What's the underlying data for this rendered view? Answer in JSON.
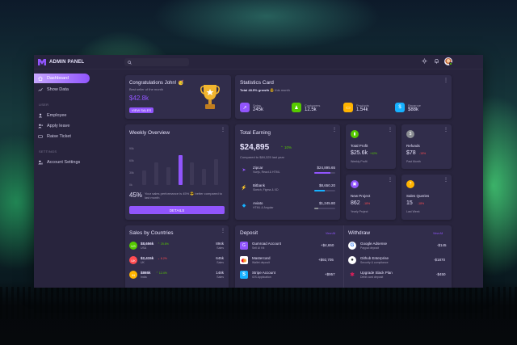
{
  "app": {
    "title": "ADMIN PANEL",
    "search_placeholder": ""
  },
  "sidebar": {
    "items": [
      {
        "label": "Dashboard",
        "icon": "home-icon",
        "active": true
      },
      {
        "label": "Show Data",
        "icon": "chart-line-icon",
        "active": false
      }
    ],
    "section_user": "USER",
    "user_items": [
      {
        "label": "Employee",
        "icon": "person-icon"
      },
      {
        "label": "Apply leave",
        "icon": "person-add-icon"
      },
      {
        "label": "Raise Ticket",
        "icon": "ticket-icon"
      }
    ],
    "section_settings": "SETTINGS",
    "settings_items": [
      {
        "label": "Account Settings",
        "icon": "account-settings-icon"
      }
    ]
  },
  "congrats": {
    "title": "Congratulations John! 🥳",
    "subtitle": "Best seller of the month",
    "amount": "$42.8k",
    "button": "VIEW SALES"
  },
  "statistics": {
    "title": "Statistics Card",
    "growth": "Total 48.5% growth",
    "growth_suffix": "😎 this month",
    "items": [
      {
        "label": "Sales",
        "value": "245k",
        "color": "#9155fd",
        "icon": "trending-up-icon"
      },
      {
        "label": "Customers",
        "value": "12.5k",
        "color": "#56ca00",
        "icon": "account-icon"
      },
      {
        "label": "Products",
        "value": "1.54k",
        "color": "#ffb400",
        "icon": "cellphone-icon"
      },
      {
        "label": "Revenue",
        "value": "$88k",
        "color": "#16b1ff",
        "icon": "currency-icon"
      }
    ]
  },
  "weekly": {
    "title": "Weekly Overview",
    "ticks": [
      "90k",
      "60k",
      "30k",
      "0k"
    ],
    "percent": "45%",
    "description": "Your sales performance is 45% 😎 better compared to last month",
    "button": "DETAILS",
    "chart_data": {
      "type": "bar",
      "categories": [
        "",
        "",
        "",
        "",
        "",
        "",
        ""
      ],
      "values": [
        37,
        57,
        45,
        75,
        57,
        40,
        65
      ],
      "ylim": [
        0,
        90
      ]
    }
  },
  "earning": {
    "title": "Total Earning",
    "amount": "$24,895",
    "change": "10%",
    "compared": "Compared to $84,325 last year",
    "rows": [
      {
        "name": "Zipcar",
        "sub": "Vuejs, React & HTML",
        "value": "$24,895.65",
        "progress": 0.75,
        "color": "#9155fd",
        "icon": "zipcar-icon"
      },
      {
        "name": "Bitbank",
        "sub": "Sketch, Figma & XD",
        "value": "$8,650.20",
        "progress": 0.5,
        "color": "#16b1ff",
        "icon": "bitbank-icon"
      },
      {
        "name": "Aviato",
        "sub": "HTML & Angular",
        "value": "$1,245.80",
        "progress": 0.2,
        "color": "#8a8d93",
        "icon": "aviato-icon"
      }
    ]
  },
  "total_profit": {
    "title": "Total Profit",
    "value": "$25.6k",
    "change": "+42%",
    "sub": "Weekly Profit",
    "color": "#56ca00",
    "icon": "poll-icon"
  },
  "refunds": {
    "title": "Refunds",
    "value": "$78",
    "change": "-15%",
    "sub": "Past Month",
    "color": "#8a8d93",
    "icon": "currency-icon"
  },
  "new_project": {
    "title": "New Project",
    "value": "862",
    "change": "-18%",
    "sub": "Yearly Project",
    "color": "#9155fd",
    "icon": "briefcase-icon"
  },
  "sales_queries": {
    "title": "Sales Queries",
    "value": "15",
    "change": "-18%",
    "sub": "Last Week",
    "color": "#ffb400",
    "icon": "help-icon"
  },
  "countries": {
    "title": "Sales by Countries",
    "rows": [
      {
        "code": "US",
        "amount": "$8,656k",
        "change": "25.8%",
        "up": true,
        "country": "USA",
        "sales": "894k",
        "sales_label": "Sales",
        "color": "#56ca00"
      },
      {
        "code": "UK",
        "amount": "$2,415k",
        "change": "6.2%",
        "up": false,
        "country": "UK",
        "sales": "645k",
        "sales_label": "Sales",
        "color": "#ff4c51"
      },
      {
        "code": "IN",
        "amount": "$865k",
        "change": "12.4%",
        "up": true,
        "country": "India",
        "sales": "148k",
        "sales_label": "Sales",
        "color": "#ffb400"
      }
    ]
  },
  "deposit": {
    "title": "Deposit",
    "view_all": "View All",
    "rows": [
      {
        "name": "Gumroad Account",
        "sub": "Sell UI Kit",
        "value": "+$4,650",
        "icon": "gumroad-icon",
        "color": "#9155fd"
      },
      {
        "name": "Mastercard",
        "sub": "Wallet deposit",
        "value": "+$92,705",
        "icon": "mastercard-icon",
        "color": "#ff4c51"
      },
      {
        "name": "Stripe Account",
        "sub": "iOS Application",
        "value": "+$957",
        "icon": "stripe-icon",
        "color": "#16b1ff"
      }
    ]
  },
  "withdraw": {
    "title": "Withdraw",
    "view_all": "View All",
    "rows": [
      {
        "name": "Google Adsense",
        "sub": "Paypal deposit",
        "value": "-$145",
        "icon": "google-icon"
      },
      {
        "name": "Github Enterprise",
        "sub": "Security & compliance",
        "value": "-$1870",
        "icon": "github-icon"
      },
      {
        "name": "Upgrade Slack Plan",
        "sub": "Debit card deposit",
        "value": "-$450",
        "icon": "slack-icon"
      }
    ]
  }
}
